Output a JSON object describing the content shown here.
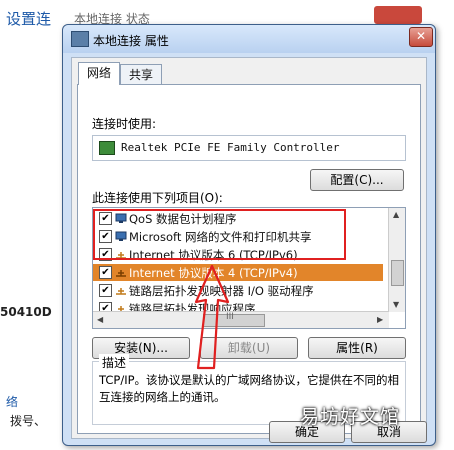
{
  "background": {
    "title": "设置连",
    "window_title": "本地连接 状态",
    "left_text_1": "50410D",
    "left_text_2": "络",
    "left_text_3": "拨号、"
  },
  "dialog": {
    "title": "本地连接 属性",
    "close_label": "✕",
    "tabs": [
      {
        "label": "网络",
        "active": true
      },
      {
        "label": "共享",
        "active": false
      }
    ],
    "connect_using_label": "连接时使用:",
    "adapter_name": "Realtek PCIe FE Family Controller",
    "configure_button": "配置(C)...",
    "items_label": "此连接使用下列项目(O):",
    "items": [
      {
        "label": "QoS 数据包计划程序",
        "checked": true,
        "selected": false,
        "icon": "network-client-icon"
      },
      {
        "label": "Microsoft 网络的文件和打印机共享",
        "checked": true,
        "selected": false,
        "icon": "network-client-icon"
      },
      {
        "label": "Internet 协议版本 6 (TCP/IPv6)",
        "checked": true,
        "selected": false,
        "icon": "protocol-icon"
      },
      {
        "label": "Internet 协议版本 4 (TCP/IPv4)",
        "checked": true,
        "selected": true,
        "icon": "protocol-icon"
      },
      {
        "label": "链路层拓扑发现映射器 I/O 驱动程序",
        "checked": true,
        "selected": false,
        "icon": "protocol-icon"
      },
      {
        "label": "链路层拓扑发现响应程序",
        "checked": true,
        "selected": false,
        "icon": "protocol-icon"
      }
    ],
    "hscroll_grip": "III",
    "install_button": "安装(N)...",
    "uninstall_button": "卸载(U)",
    "properties_button": "属性(R)",
    "description_title": "描述",
    "description_text": "TCP/IP。该协议是默认的广域网络协议，它提供在不同的相互连接的网络上的通讯。",
    "ok_button": "确定",
    "cancel_button": "取消"
  },
  "watermark": "易坊好文馆",
  "colors": {
    "selection": "#e2852a",
    "annotation": "#e02020"
  }
}
